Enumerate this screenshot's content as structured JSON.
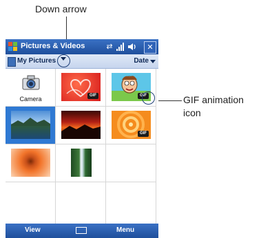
{
  "callouts": {
    "down_arrow": "Down arrow",
    "gif_line1": "GIF animation",
    "gif_line2": "icon"
  },
  "titlebar": {
    "title": "Pictures & Videos",
    "status_icons": [
      "sync-icon",
      "signal-icon",
      "volume-icon"
    ],
    "close_label": "✕"
  },
  "toolbar": {
    "folder_label": "My Pictures",
    "sort_label": "Date"
  },
  "grid": {
    "camera_label": "Camera",
    "gif_badge": "GIF",
    "items": [
      {
        "name": "camera",
        "kind": "camera"
      },
      {
        "name": "heart-image",
        "kind": "image",
        "gif": true
      },
      {
        "name": "cartoon-image",
        "kind": "image",
        "gif": true
      },
      {
        "name": "lake-image",
        "kind": "image",
        "gif": false,
        "selected": true
      },
      {
        "name": "sunset-image",
        "kind": "image",
        "gif": false
      },
      {
        "name": "orange-circles-image",
        "kind": "image",
        "gif": true
      },
      {
        "name": "flower-image",
        "kind": "image",
        "gif": false
      },
      {
        "name": "waterfall-image",
        "kind": "image",
        "gif": false
      }
    ]
  },
  "menubar": {
    "left_label": "View",
    "right_label": "Menu"
  },
  "colors": {
    "titlebar": "#2a5fb0",
    "selection": "#2f79d3"
  }
}
